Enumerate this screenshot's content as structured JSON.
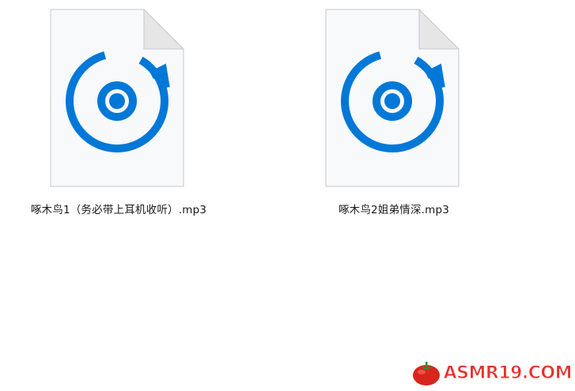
{
  "files": [
    {
      "name": "啄木鸟1（务必带上耳机收听）.mp3",
      "icon": "groove-music-file-icon"
    },
    {
      "name": "啄木鸟2姐弟情深.mp3",
      "icon": "groove-music-file-icon"
    }
  ],
  "watermark": {
    "text": "ASMR19.COM",
    "icon": "tomato-logo-icon"
  },
  "colors": {
    "accent": "#0078d7",
    "page_fold": "#e6e6e6",
    "page_bg": "#f8f9fb",
    "page_border": "#c8c8c8",
    "watermark": "#e8302a"
  }
}
